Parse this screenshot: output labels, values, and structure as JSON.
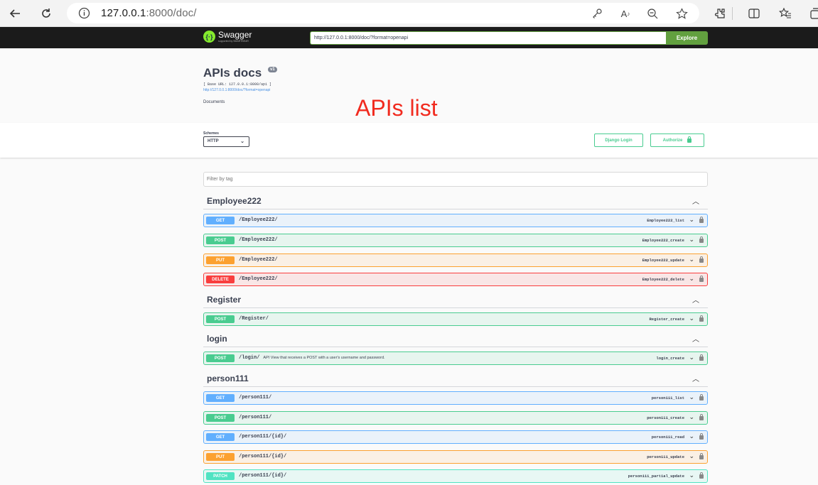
{
  "browser": {
    "url_host": "127.0.0.1",
    "url_rest": ":8000/doc/"
  },
  "topbar": {
    "logo_text": "Swagger",
    "logo_sub": "supported by SMARTBEAR",
    "explore_url": "http://127.0.0.1:8000/doc/?format=openapi",
    "explore_label": "Explore"
  },
  "info": {
    "title": "APIs docs",
    "version": "v1",
    "base_url": "[ Base URL: 127.0.0.1:8000/api ]",
    "spec_link": "http://127.0.0.1:8000/doc/?format=openapi",
    "description": "Documents"
  },
  "annotation": "APIs list",
  "schemes": {
    "label": "Schemes",
    "selected": "HTTP",
    "django_login": "Django Login",
    "authorize": "Authorize"
  },
  "filter": {
    "placeholder": "Filter by tag"
  },
  "tags": [
    {
      "name": "Employee222",
      "operations": [
        {
          "method": "GET",
          "path": "/Employee222/",
          "summary": "",
          "operation_id": "Employee222_list"
        },
        {
          "method": "POST",
          "path": "/Employee222/",
          "summary": "",
          "operation_id": "Employee222_create"
        },
        {
          "method": "PUT",
          "path": "/Employee222/",
          "summary": "",
          "operation_id": "Employee222_update"
        },
        {
          "method": "DELETE",
          "path": "/Employee222/",
          "summary": "",
          "operation_id": "Employee222_delete"
        }
      ]
    },
    {
      "name": "Register",
      "operations": [
        {
          "method": "POST",
          "path": "/Register/",
          "summary": "",
          "operation_id": "Register_create"
        }
      ]
    },
    {
      "name": "login",
      "operations": [
        {
          "method": "POST",
          "path": "/login/",
          "summary": "API View that receives a POST with a user's username and password.",
          "operation_id": "login_create"
        }
      ]
    },
    {
      "name": "person111",
      "operations": [
        {
          "method": "GET",
          "path": "/person111/",
          "summary": "",
          "operation_id": "person111_list"
        },
        {
          "method": "POST",
          "path": "/person111/",
          "summary": "",
          "operation_id": "person111_create"
        },
        {
          "method": "GET",
          "path": "/person111/{id}/",
          "summary": "",
          "operation_id": "person111_read"
        },
        {
          "method": "PUT",
          "path": "/person111/{id}/",
          "summary": "",
          "operation_id": "person111_update"
        },
        {
          "method": "PATCH",
          "path": "/person111/{id}/",
          "summary": "",
          "operation_id": "person111_partial_update"
        }
      ]
    }
  ]
}
